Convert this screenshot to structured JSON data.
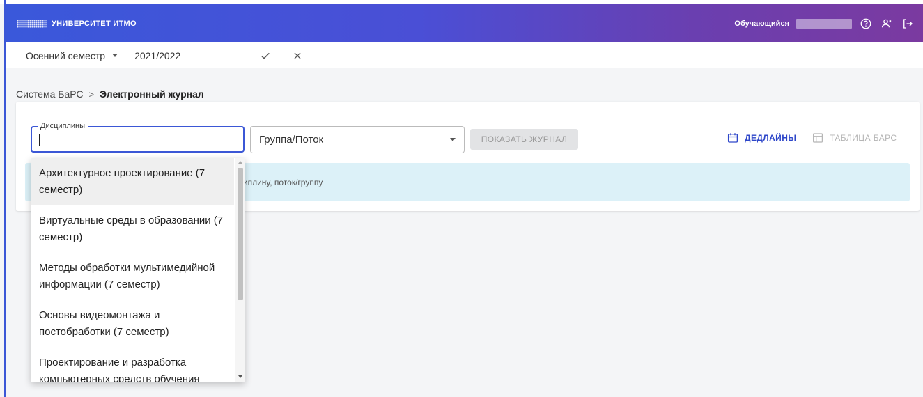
{
  "header": {
    "logo_text": "УНИВЕРСИТЕТ ИТМО",
    "role": "Обучающийся",
    "icons": [
      "help-circle-icon",
      "user-settings-icon",
      "logout-icon"
    ]
  },
  "semester_bar": {
    "semester": "Осенний семестр",
    "year": "2021/2022"
  },
  "breadcrumb": {
    "root": "Система БаРС",
    "separator": ">",
    "current": "Электронный журнал"
  },
  "filters": {
    "disciplines_label": "Дисциплины",
    "disciplines_value": "",
    "group_value": "Группа/Поток",
    "show_button": "ПОКАЗАТЬ ЖУРНАЛ",
    "deadlines_button": "ДЕДЛАЙНЫ",
    "table_button": "ТАБЛИЦА БАРС"
  },
  "info": {
    "text": "циплину, поток/группу"
  },
  "dropdown": {
    "items": [
      {
        "label": "Архитектурное проектирование (7 семестр)"
      },
      {
        "label": "Виртуальные среды в образовании (7 семестр)"
      },
      {
        "label": "Методы обработки мультимедийной информации (7 семестр)"
      },
      {
        "label": "Основы видеомонтажа и постобработки (7 семестр)"
      },
      {
        "label": "Проектирование и разработка компьютерных средств обучения"
      }
    ]
  },
  "colors": {
    "accent": "#3b57d6",
    "header_gradient_start": "#3a58da",
    "header_gradient_end": "#7b3aa0",
    "info_bg": "#dcf1f8"
  }
}
